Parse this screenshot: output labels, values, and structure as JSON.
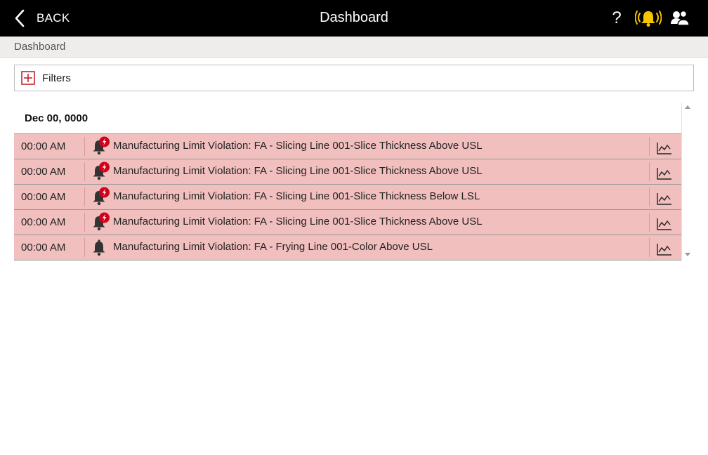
{
  "header": {
    "back_label": "BACK",
    "title": "Dashboard",
    "help_label": "?",
    "icons": {
      "back": "chevron-left-icon",
      "help": "question-icon",
      "alarm": "alarm-bell-icon",
      "users": "users-icon"
    },
    "alarm_color": "#f7c600"
  },
  "breadcrumb": {
    "label": "Dashboard"
  },
  "filters": {
    "label": "Filters",
    "icon": "plus-square-icon",
    "icon_color": "#c0272d"
  },
  "list": {
    "date": "Dec 00, 0000",
    "row_color": "#f2bfbf",
    "rows": [
      {
        "time": "00:00 AM",
        "message": "Manufacturing Limit Violation: FA - Slicing Line 001-Slice Thickness Above USL",
        "badge": true
      },
      {
        "time": "00:00 AM",
        "message": "Manufacturing Limit Violation: FA - Slicing Line 001-Slice Thickness Above USL",
        "badge": true
      },
      {
        "time": "00:00 AM",
        "message": "Manufacturing Limit Violation: FA - Slicing Line 001-Slice Thickness Below LSL",
        "badge": true
      },
      {
        "time": "00:00 AM",
        "message": "Manufacturing Limit Violation: FA - Slicing Line 001-Slice Thickness Above USL",
        "badge": true
      },
      {
        "time": "00:00 AM",
        "message": "Manufacturing Limit Violation: FA - Frying Line 001-Color Above USL",
        "badge": false
      }
    ]
  }
}
